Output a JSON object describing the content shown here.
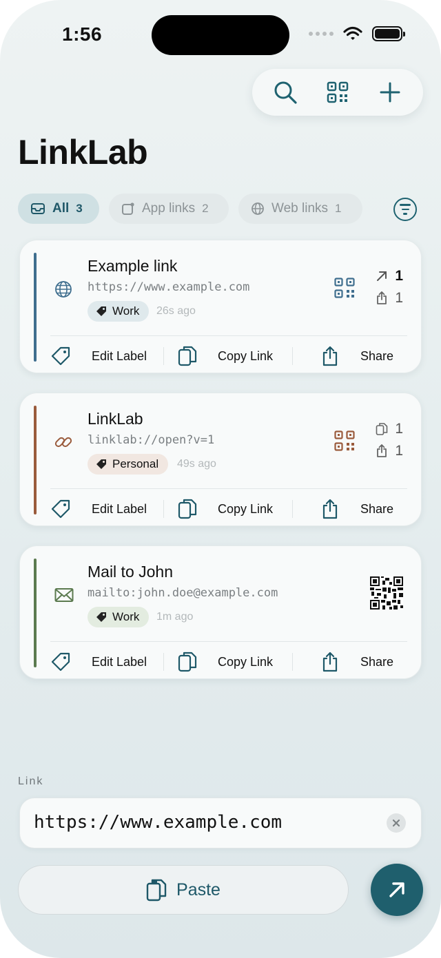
{
  "status": {
    "time": "1:56"
  },
  "toolbar": {
    "search_icon": "search-icon",
    "qr_icon": "qr-code-icon",
    "add_icon": "plus-icon"
  },
  "app": {
    "title": "LinkLab"
  },
  "filters": [
    {
      "label": "All",
      "count": "3",
      "icon": "tray-icon",
      "active": true
    },
    {
      "label": "App links",
      "count": "2",
      "icon": "app-icon",
      "active": false
    },
    {
      "label": "Web links",
      "count": "1",
      "icon": "globe-icon",
      "active": false
    }
  ],
  "cards": [
    {
      "title": "Example link",
      "url": "https://www.example.com",
      "tag": "Work",
      "ago": "26s ago",
      "accent": "#3f6e8e",
      "type_icon": "globe-icon",
      "stats": [
        {
          "icon": "arrow-up-right-icon",
          "value": "1"
        },
        {
          "icon": "share-icon",
          "value": "1"
        }
      ]
    },
    {
      "title": "LinkLab",
      "url": "linklab://open?v=1",
      "tag": "Personal",
      "ago": "49s ago",
      "accent": "#9a5b3c",
      "type_icon": "link-icon",
      "stats": [
        {
          "icon": "copy-icon",
          "value": "1"
        },
        {
          "icon": "share-icon",
          "value": "1"
        }
      ]
    },
    {
      "title": "Mail to John",
      "url": "mailto:john.doe@example.com",
      "tag": "Work",
      "ago": "1m ago",
      "accent": "#5b7a4f",
      "type_icon": "envelope-icon",
      "stats": []
    }
  ],
  "actions": {
    "edit_label": "Edit Label",
    "copy_link": "Copy Link",
    "share": "Share"
  },
  "input": {
    "label": "Link",
    "value": "https://www.example.com"
  },
  "paste": {
    "label": "Paste"
  },
  "colors": {
    "accent": "#1f5f6d",
    "background": "#e6eeef"
  }
}
